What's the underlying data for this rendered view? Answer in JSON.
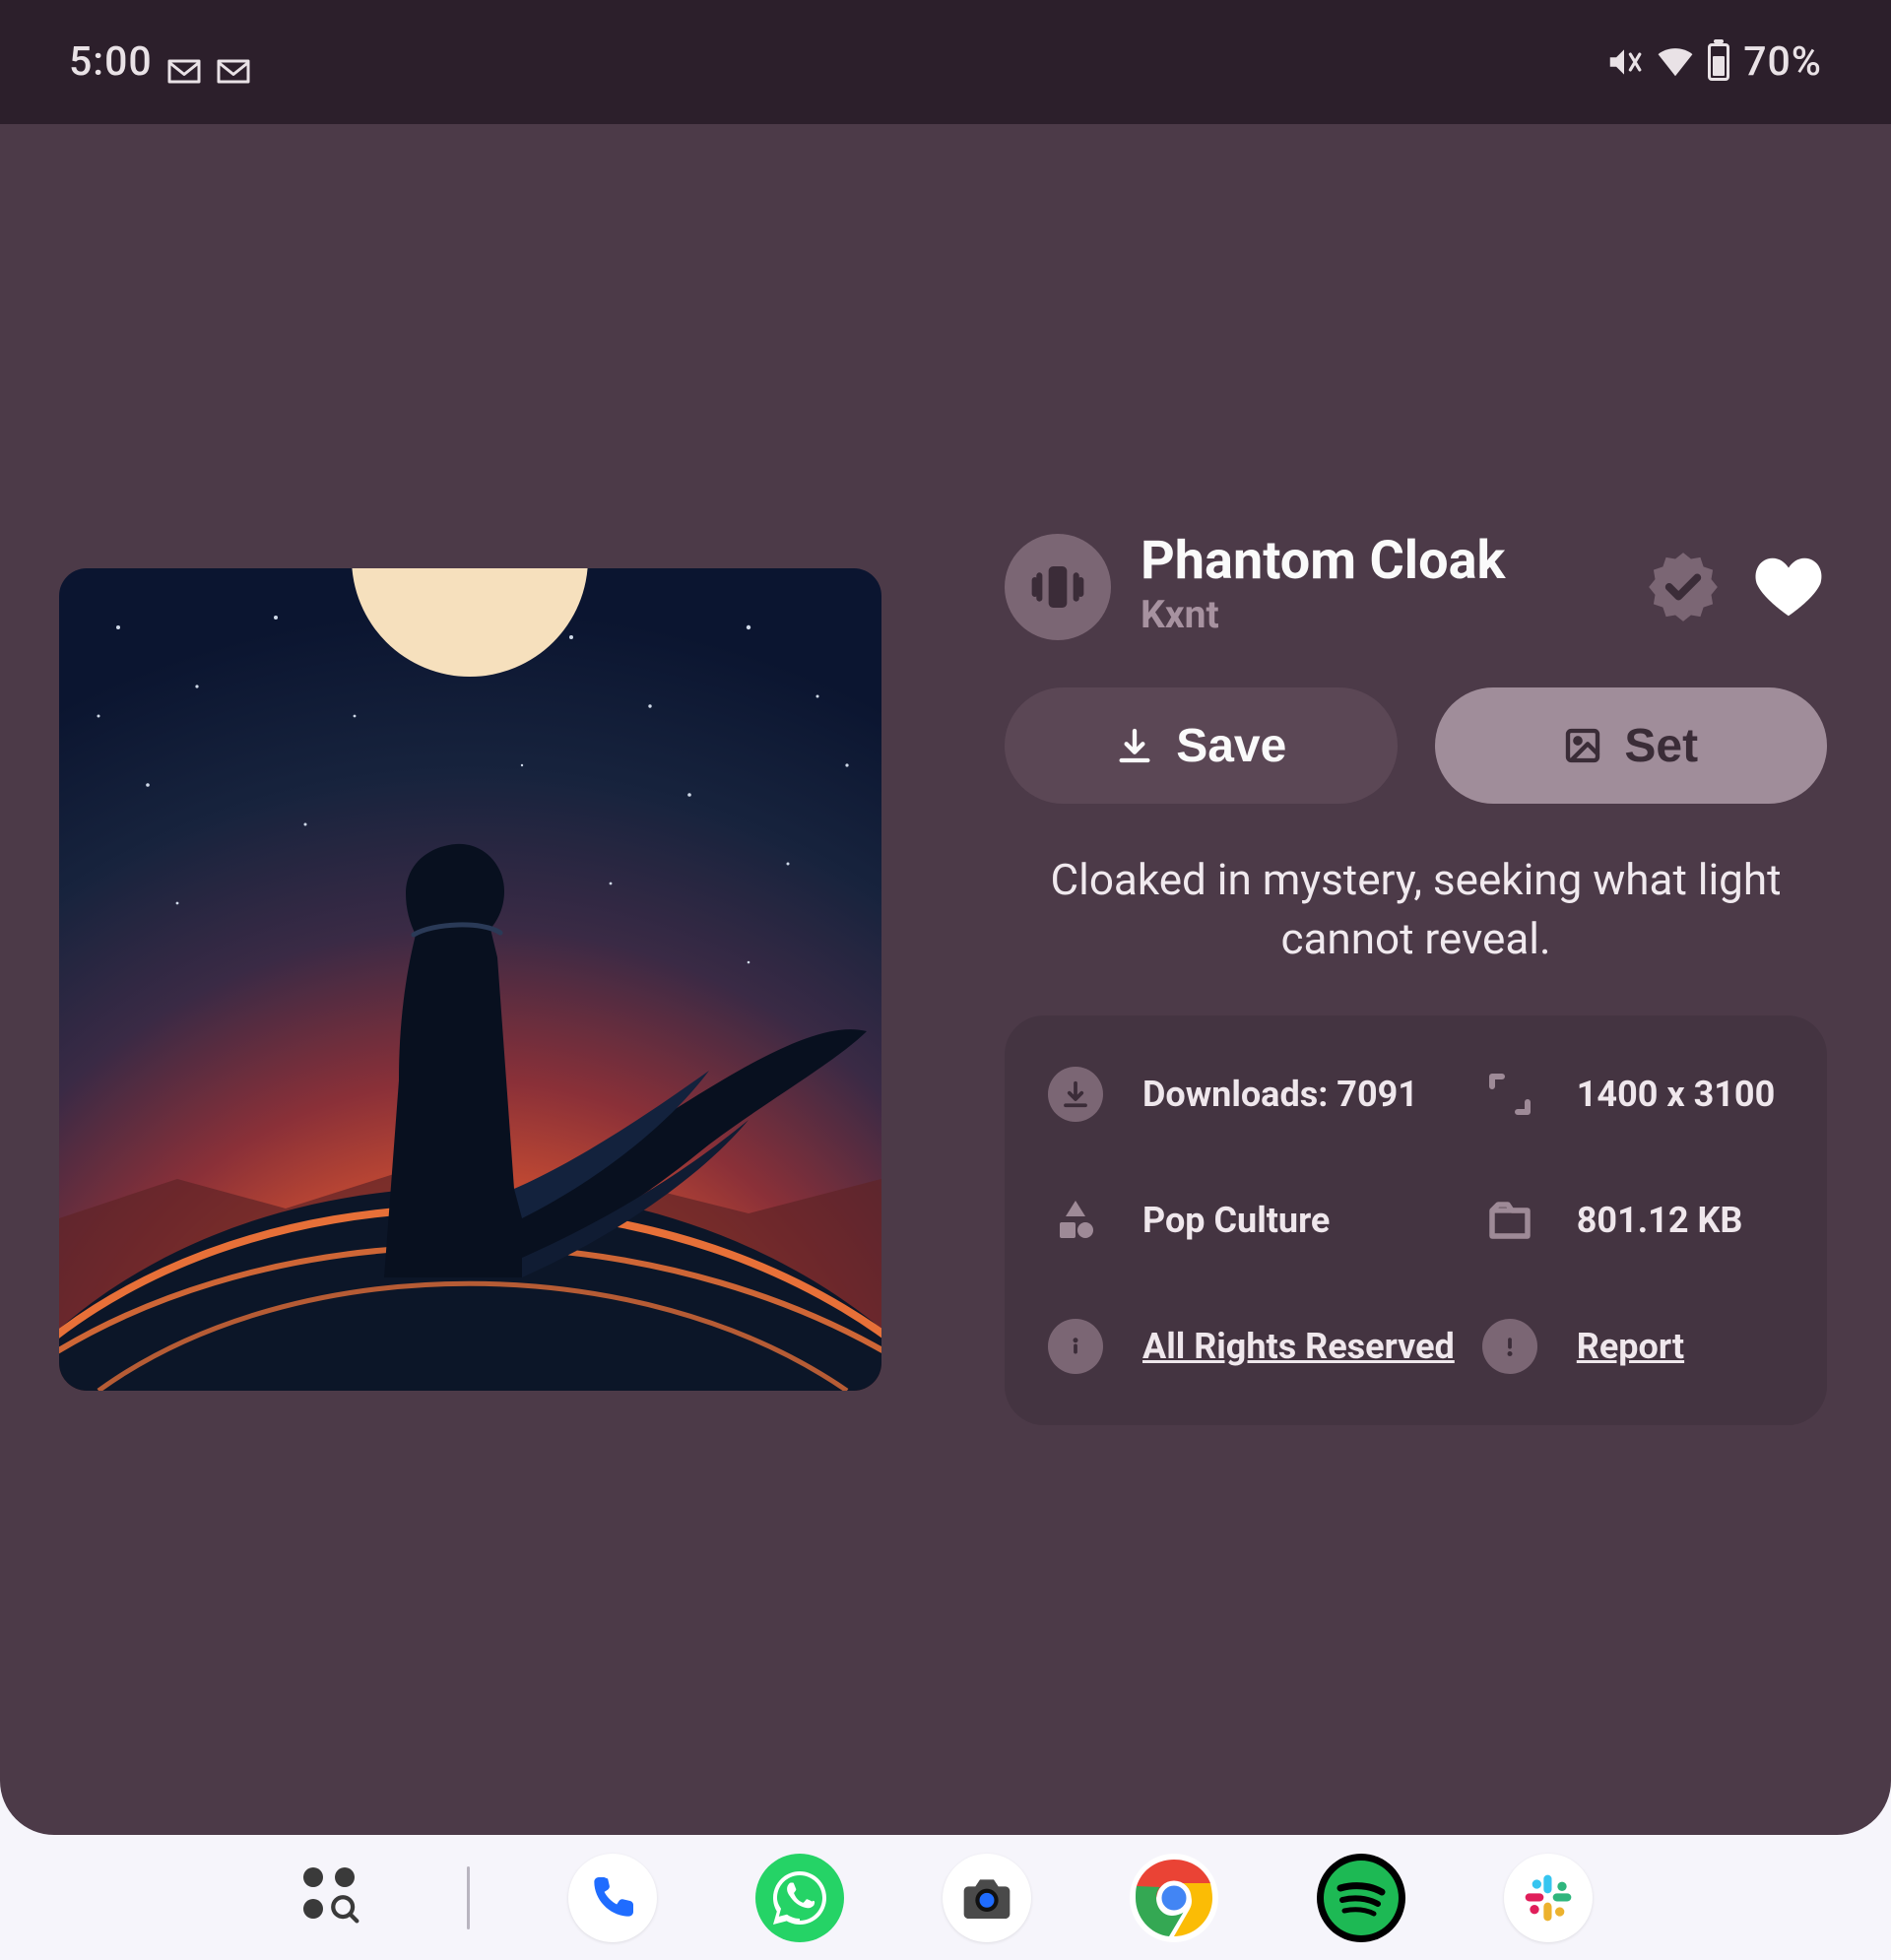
{
  "statusbar": {
    "time": "5:00",
    "battery_text": "70%"
  },
  "wallpaper": {
    "title": "Phantom Cloak",
    "author": "Kxnt",
    "buttons": {
      "save": "Save",
      "set": "Set"
    },
    "description": "Cloaked in mystery, seeking what light cannot reveal.",
    "meta": {
      "downloads_label": "Downloads: 7091",
      "dimensions": "1400 x 3100",
      "category": "Pop Culture",
      "filesize": "801.12 KB",
      "license": "All Rights Reserved",
      "report": "Report"
    }
  },
  "colors": {
    "card_bg": "#4c3a48",
    "panel_bg": "#443441",
    "chip_bg": "#7b6674",
    "accent_muted": "#a792a0"
  }
}
